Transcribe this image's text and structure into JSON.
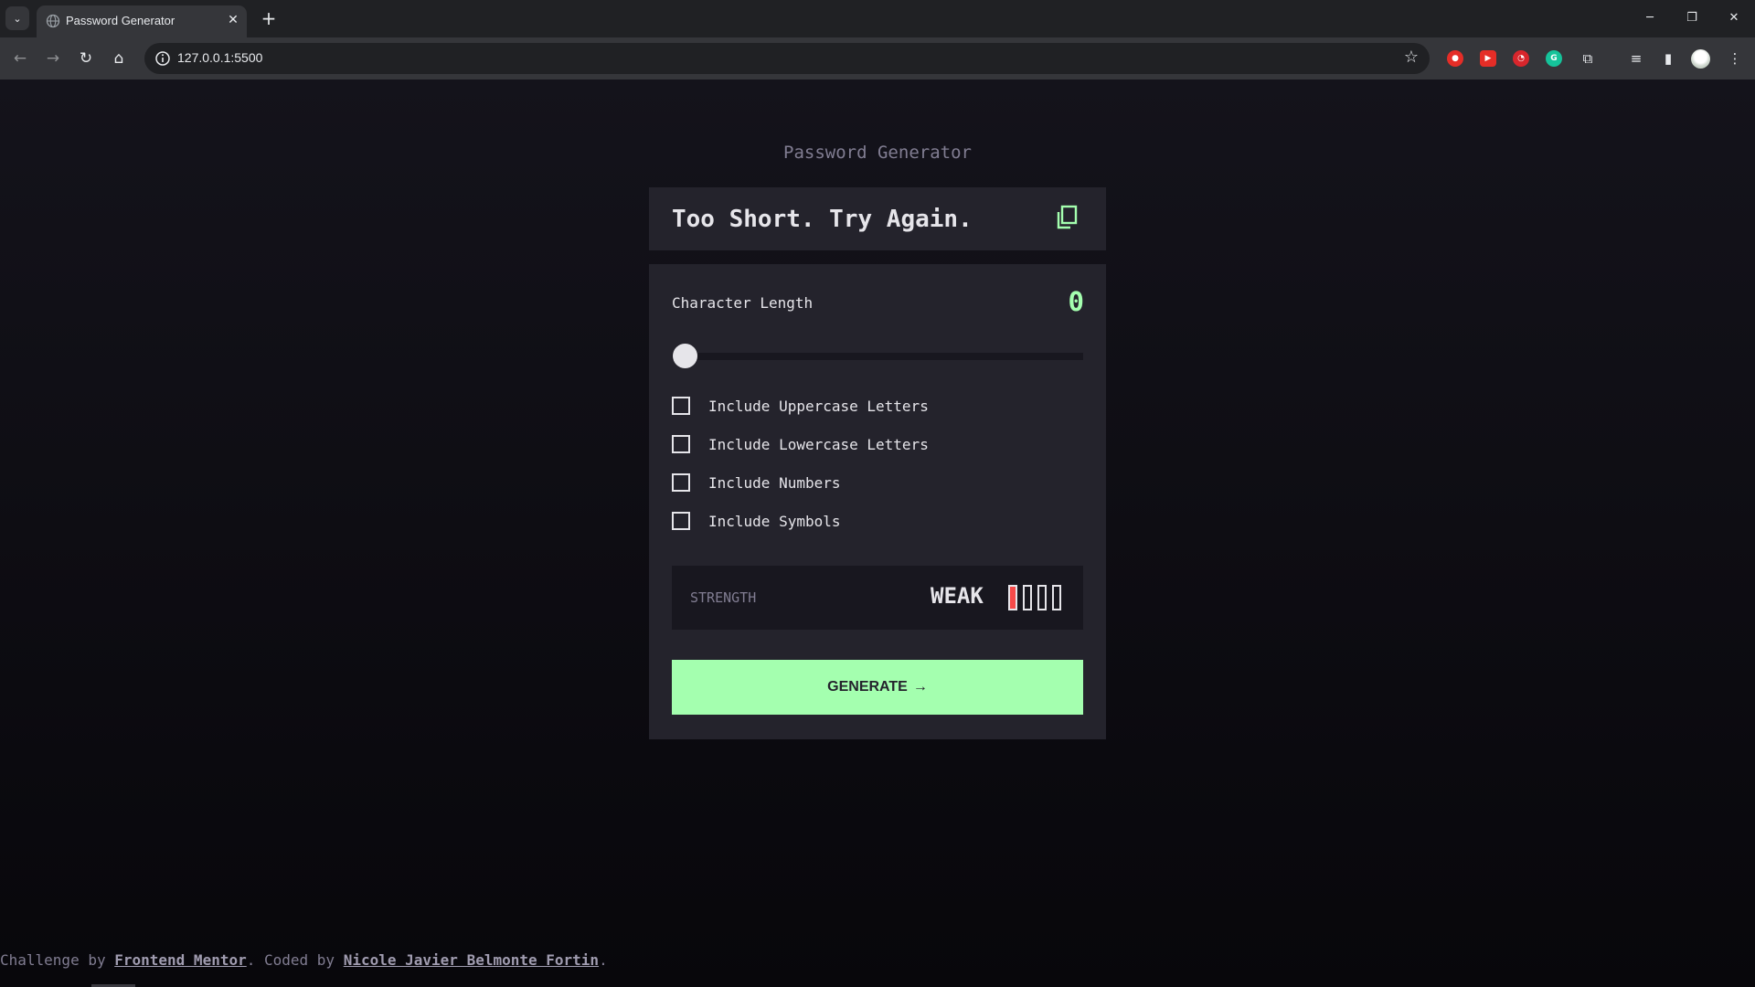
{
  "browser": {
    "tab_title": "Password Generator",
    "url": "127.0.0.1:5500",
    "icons": [
      "tab-list-icon",
      "globe-icon",
      "close-icon",
      "plus-icon",
      "minimize-icon",
      "restore-icon",
      "close-window-icon",
      "back-icon",
      "forward-icon",
      "reload-icon",
      "home-icon",
      "site-info-icon",
      "star-icon",
      "extensions-icon",
      "media-icon",
      "side-panel-icon",
      "menu-icon"
    ],
    "glyphs": {
      "tab_list": "⌄",
      "tab_close": "✕",
      "new_tab": "+",
      "minimize": "─",
      "restore": "❐",
      "close_window": "✕",
      "back": "←",
      "forward": "→",
      "reload": "↻",
      "home": "⌂",
      "star": "☆",
      "puzzle": "⧉",
      "media": "≡",
      "side_panel": "▮",
      "menu": "⋮"
    }
  },
  "app": {
    "title": "Password Generator",
    "password_text": "Too Short. Try Again.",
    "character_length_label": "Character Length",
    "character_length_value": "0",
    "slider_value": 0,
    "options": [
      {
        "label": "Include Uppercase Letters",
        "checked": false
      },
      {
        "label": "Include Lowercase Letters",
        "checked": false
      },
      {
        "label": "Include Numbers",
        "checked": false
      },
      {
        "label": "Include Symbols",
        "checked": false
      }
    ],
    "strength_label": "STRENGTH",
    "strength_value": "WEAK",
    "strength_bars_filled": 1,
    "strength_bars_total": 4,
    "generate_label": "GENERATE",
    "generate_arrow": "→",
    "colors": {
      "accent": "#a4ffaf",
      "weak": "#f64a4a",
      "panel": "#24232c",
      "text": "#e6e5ea",
      "muted": "#817d92"
    }
  },
  "footer": {
    "prefix": "Challenge by ",
    "link1": "Frontend Mentor",
    "middle": ". Coded by ",
    "link2": "Nicole Javier Belmonte Fortin",
    "suffix": "."
  }
}
